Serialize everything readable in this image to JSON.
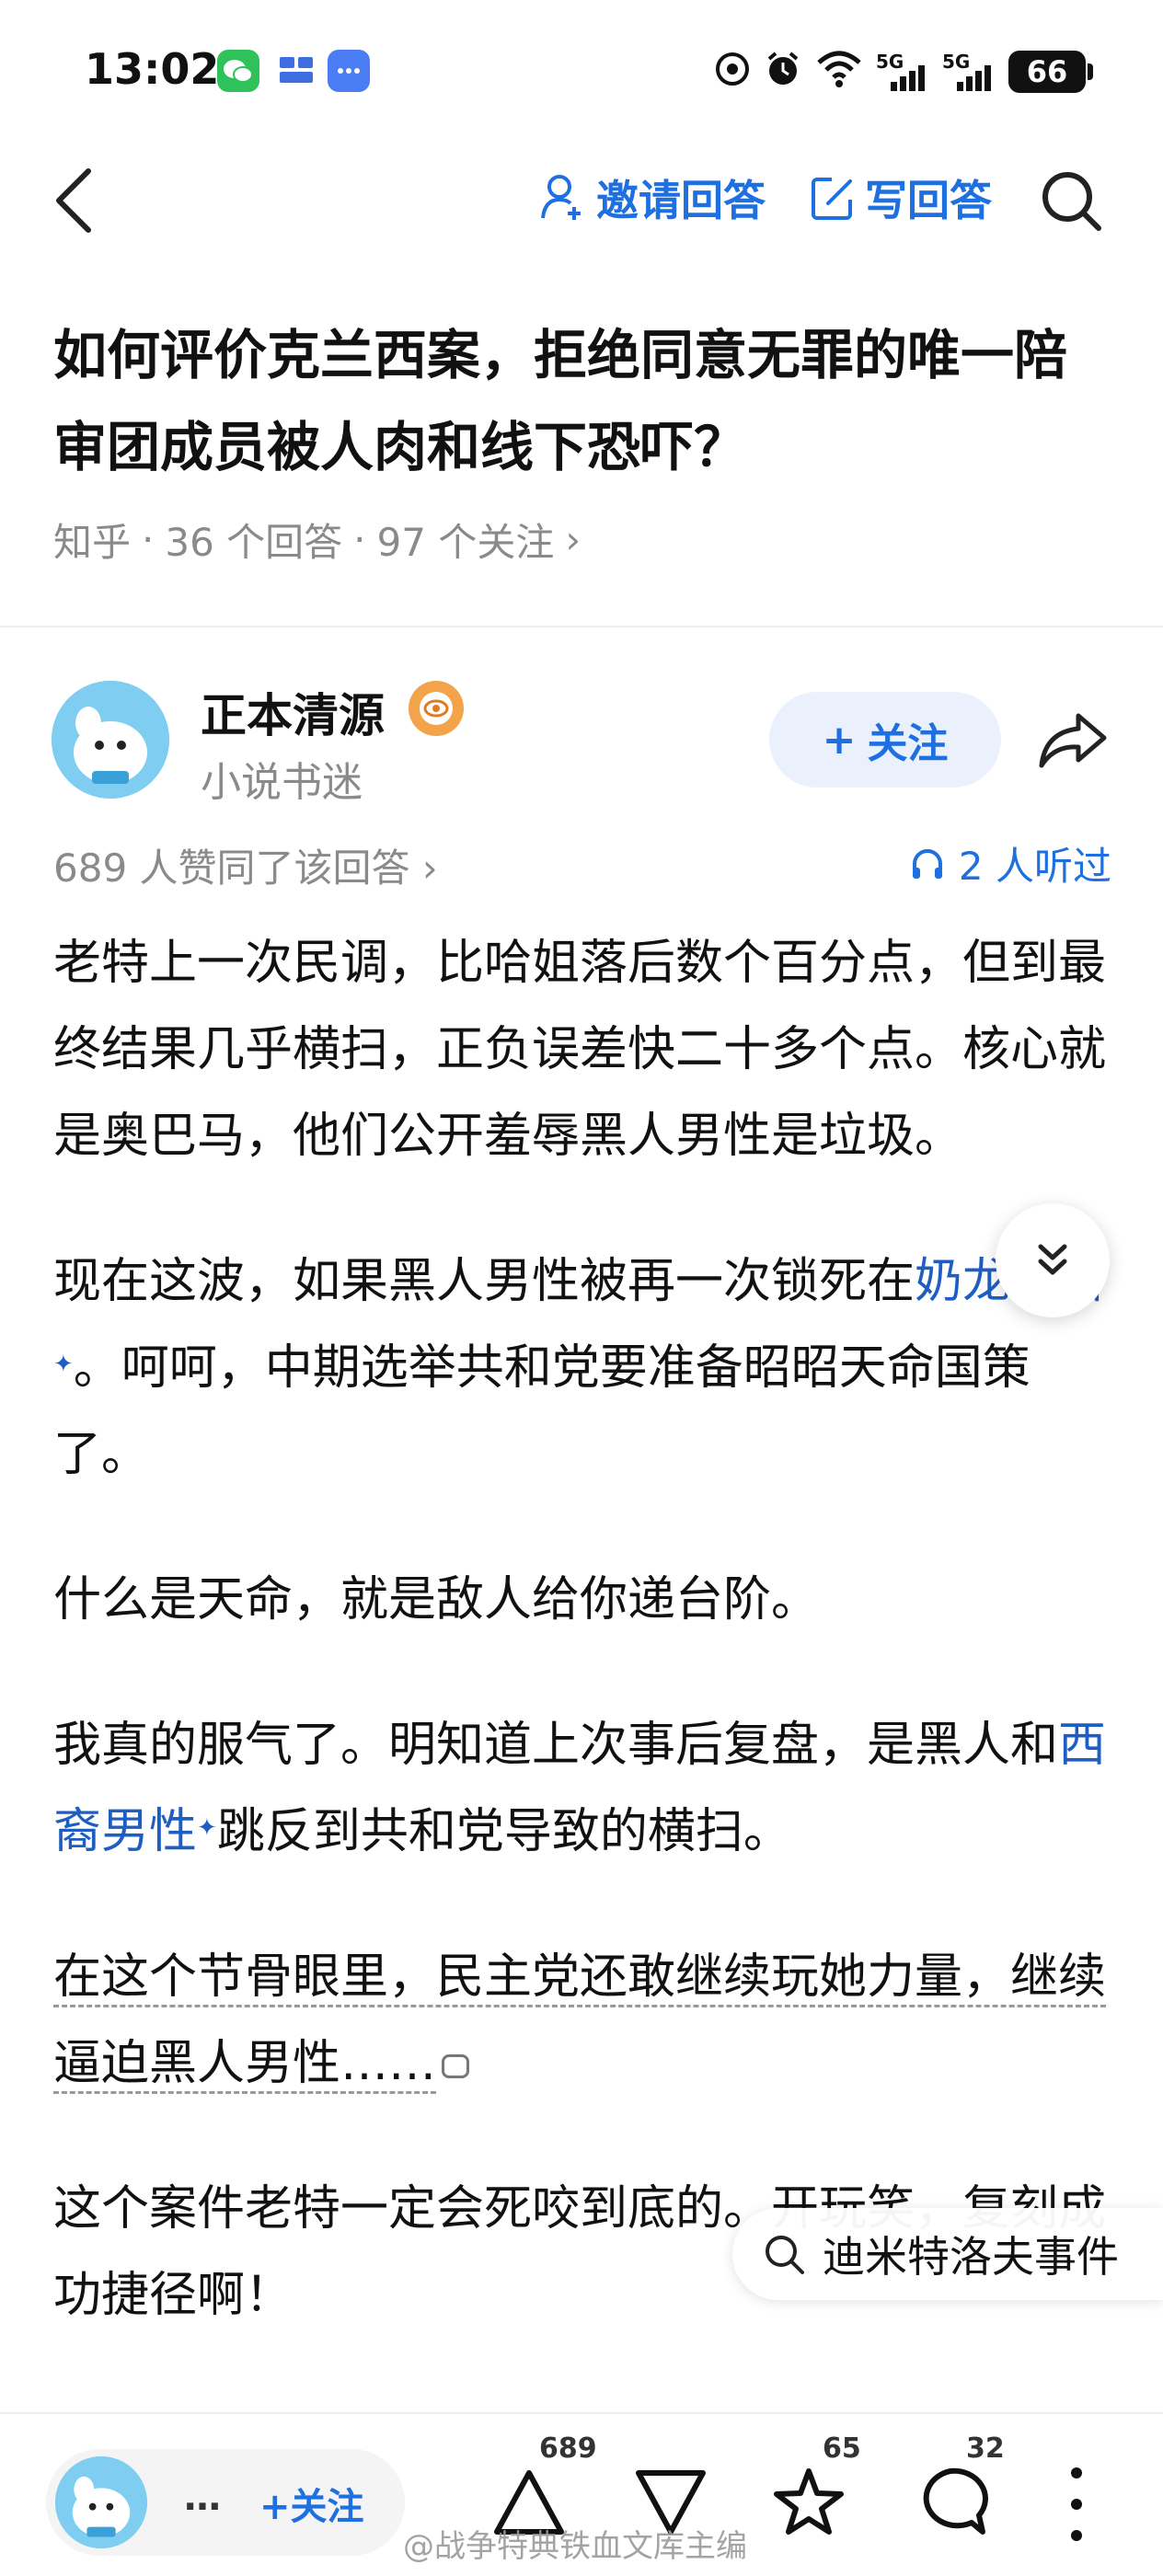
{
  "status_bar": {
    "time": "13:02",
    "battery": "66",
    "net1": "5G",
    "net2": "5G"
  },
  "nav": {
    "invite_label": "邀请回答",
    "write_label": "写回答"
  },
  "question": {
    "title": "如何评价克兰西案，拒绝同意无罪的唯一陪审团成员被人肉和线下恐吓？",
    "source": "知乎",
    "answers": "36 个回答",
    "followers": "97 个关注",
    "chevron": "›"
  },
  "author": {
    "name": "正本清源",
    "bio": "小说书迷",
    "follow_label": "关注",
    "plus": "+"
  },
  "stats": {
    "upvotes_text": "689 人赞同了该回答 ›",
    "listeners": "2 人听过"
  },
  "answer": {
    "p1": "老特上一次民调，比哈姐落后数个百分点，但到最终结果几乎横扫，正负误差快二十多个点。核心就是奥巴马，他们公开羞辱黑人男性是垃圾。",
    "p2_a": "现在这波，如果黑人男性被再一次锁死在",
    "p2_link": "奶龙阵营",
    "p2_b": "。呵呵，中期选举共和党要准备昭昭天命国策了。",
    "p3": "什么是天命，就是敌人给你递台阶。",
    "p4_a": "我真的服气了。明知道上次事后复盘，是黑人和",
    "p4_link": "西裔男性",
    "p4_b": "跳反到共和党导致的横扫。",
    "p5": "在这个节骨眼里，民主党还敢继续玩她力量，继续逼迫黑人男性……",
    "p6": "这个案件老特一定会死咬到底的。开玩笑，复刻成功捷径啊！",
    "spark": "✦"
  },
  "search_chip": {
    "label": "迪米特洛夫事件"
  },
  "bottom": {
    "ellipsis": "…",
    "follow_label": "+关注",
    "upvotes": "689",
    "favorites": "65",
    "comments": "32",
    "watermark": "@战争特典铁血文库主编"
  },
  "colors": {
    "accent": "#1e6fe0",
    "link": "#1e5ec2",
    "muted": "#8a8a8a"
  },
  "icons": [
    "back-icon",
    "add-user-icon",
    "edit-icon",
    "search-icon",
    "share-icon",
    "headphones-icon",
    "chevron-double-down-icon",
    "upvote-icon",
    "downvote-icon",
    "star-icon",
    "comment-icon",
    "more-icon"
  ]
}
